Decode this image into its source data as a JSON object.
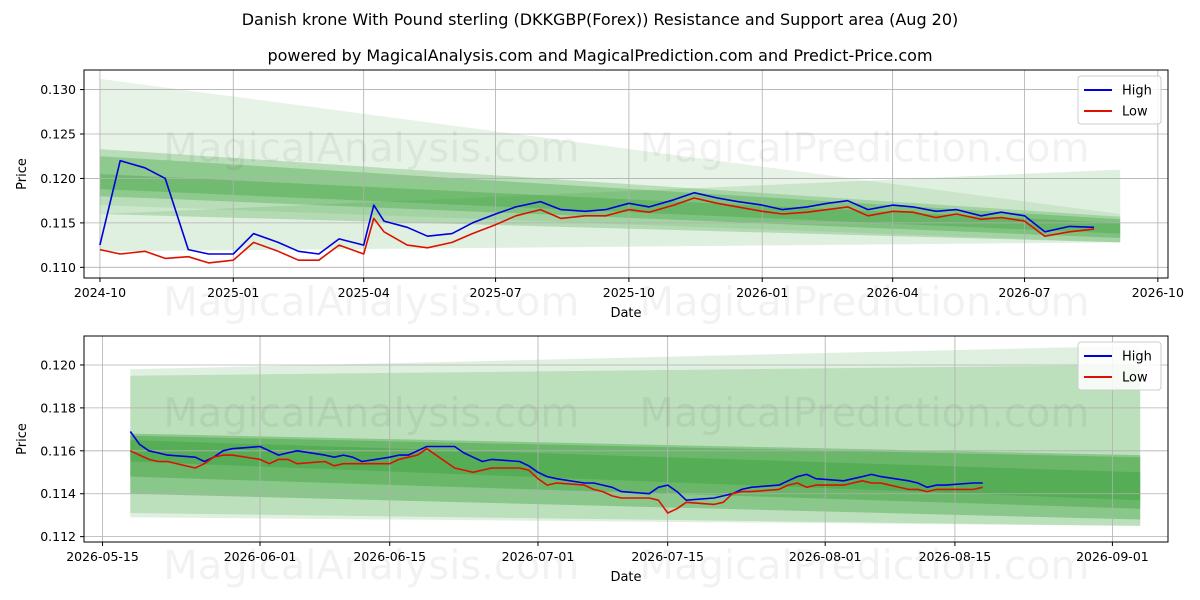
{
  "header": {
    "title": "Danish krone With Pound sterling (DKKGBP(Forex)) Resistance and Support area (Aug 20)",
    "subtitle": "powered by MagicalAnalysis.com and MagicalPrediction.com and Predict-Price.com"
  },
  "watermarks": [
    "MagicalAnalysis.com",
    "MagicalPrediction.com"
  ],
  "colors": {
    "high": "#0000dd",
    "low": "#dd1100",
    "band": "#2e9a2e",
    "grid": "#b0b0b0"
  },
  "chart_data": [
    {
      "type": "line",
      "xlabel": "Date",
      "ylabel": "Price",
      "xlim": [
        "2024-09-20",
        "2026-10-08"
      ],
      "ylim": [
        0.1088,
        0.1322
      ],
      "xticks": [
        "2024-10-01",
        "2025-01-01",
        "2025-04-01",
        "2025-07-01",
        "2025-10-01",
        "2026-01-01",
        "2026-04-01",
        "2026-07-01",
        "2026-10-01"
      ],
      "xtick_labels": [
        "2024-10",
        "2025-01",
        "2025-04",
        "2025-07",
        "2025-10",
        "2026-01",
        "2026-04",
        "2026-07",
        "2026-10"
      ],
      "yticks": [
        0.11,
        0.115,
        0.12,
        0.125,
        0.13
      ],
      "ytick_labels": [
        "0.110",
        "0.115",
        "0.120",
        "0.125",
        "0.130"
      ],
      "grid": true,
      "legend": "top-right",
      "legend_entries": [
        "High",
        "Low"
      ],
      "bands": [
        {
          "x": [
            "2024-10-01",
            "2026-09-05"
          ],
          "upper": [
            0.1312,
            0.116
          ],
          "lower": [
            0.117,
            0.1128
          ],
          "opacity": 0.12
        },
        {
          "x": [
            "2024-10-01",
            "2026-09-05"
          ],
          "upper": [
            0.1233,
            0.1157
          ],
          "lower": [
            0.116,
            0.1128
          ],
          "opacity": 0.25
        },
        {
          "x": [
            "2024-10-01",
            "2026-09-05"
          ],
          "upper": [
            0.1225,
            0.1154
          ],
          "lower": [
            0.118,
            0.1133
          ],
          "opacity": 0.3
        },
        {
          "x": [
            "2024-10-01",
            "2026-09-05"
          ],
          "upper": [
            0.1205,
            0.115
          ],
          "lower": [
            0.1188,
            0.1138
          ],
          "opacity": 0.3
        },
        {
          "x": [
            "2024-10-01",
            "2026-09-05"
          ],
          "upper": [
            0.116,
            0.121
          ],
          "lower": [
            0.1118,
            0.1128
          ],
          "opacity": 0.15
        }
      ],
      "series": [
        {
          "name": "High",
          "x": [
            "2024-10-01",
            "2024-10-15",
            "2024-11-01",
            "2024-11-15",
            "2024-12-01",
            "2024-12-15",
            "2025-01-01",
            "2025-01-15",
            "2025-02-01",
            "2025-02-15",
            "2025-03-01",
            "2025-03-15",
            "2025-04-01",
            "2025-04-08",
            "2025-04-15",
            "2025-05-01",
            "2025-05-15",
            "2025-06-01",
            "2025-06-15",
            "2025-07-01",
            "2025-07-15",
            "2025-08-01",
            "2025-08-15",
            "2025-09-01",
            "2025-09-15",
            "2025-10-01",
            "2025-10-15",
            "2025-11-01",
            "2025-11-15",
            "2025-12-01",
            "2025-12-15",
            "2026-01-01",
            "2026-01-15",
            "2026-02-01",
            "2026-02-15",
            "2026-03-01",
            "2026-03-15",
            "2026-04-01",
            "2026-04-15",
            "2026-05-01",
            "2026-05-15",
            "2026-06-01",
            "2026-06-15",
            "2026-07-01",
            "2026-07-15",
            "2026-08-01",
            "2026-08-18"
          ],
          "values": [
            0.1125,
            0.122,
            0.1212,
            0.12,
            0.112,
            0.1115,
            0.1115,
            0.1138,
            0.1128,
            0.1118,
            0.1115,
            0.1132,
            0.1125,
            0.117,
            0.1152,
            0.1145,
            0.1135,
            0.1138,
            0.115,
            0.116,
            0.1168,
            0.1174,
            0.1165,
            0.1163,
            0.1165,
            0.1172,
            0.1168,
            0.1176,
            0.1184,
            0.1178,
            0.1174,
            0.117,
            0.1165,
            0.1168,
            0.1172,
            0.1175,
            0.1165,
            0.117,
            0.1168,
            0.1163,
            0.1165,
            0.1158,
            0.1162,
            0.1158,
            0.114,
            0.1146,
            0.1145
          ]
        },
        {
          "name": "Low",
          "x": [
            "2024-10-01",
            "2024-10-15",
            "2024-11-01",
            "2024-11-15",
            "2024-12-01",
            "2024-12-15",
            "2025-01-01",
            "2025-01-15",
            "2025-02-01",
            "2025-02-15",
            "2025-03-01",
            "2025-03-15",
            "2025-04-01",
            "2025-04-08",
            "2025-04-15",
            "2025-05-01",
            "2025-05-15",
            "2025-06-01",
            "2025-06-15",
            "2025-07-01",
            "2025-07-15",
            "2025-08-01",
            "2025-08-15",
            "2025-09-01",
            "2025-09-15",
            "2025-10-01",
            "2025-10-15",
            "2025-11-01",
            "2025-11-15",
            "2025-12-01",
            "2025-12-15",
            "2026-01-01",
            "2026-01-15",
            "2026-02-01",
            "2026-02-15",
            "2026-03-01",
            "2026-03-15",
            "2026-04-01",
            "2026-04-15",
            "2026-05-01",
            "2026-05-15",
            "2026-06-01",
            "2026-06-15",
            "2026-07-01",
            "2026-07-15",
            "2026-08-01",
            "2026-08-18"
          ],
          "values": [
            0.112,
            0.1115,
            0.1118,
            0.111,
            0.1112,
            0.1105,
            0.1108,
            0.1128,
            0.1118,
            0.1108,
            0.1108,
            0.1125,
            0.1115,
            0.1155,
            0.114,
            0.1125,
            0.1122,
            0.1128,
            0.1138,
            0.1148,
            0.1158,
            0.1165,
            0.1155,
            0.1158,
            0.1158,
            0.1165,
            0.1162,
            0.117,
            0.1178,
            0.1172,
            0.1168,
            0.1163,
            0.116,
            0.1162,
            0.1165,
            0.1168,
            0.1158,
            0.1163,
            0.1162,
            0.1156,
            0.116,
            0.1154,
            0.1156,
            0.1152,
            0.1135,
            0.114,
            0.1143
          ]
        }
      ]
    },
    {
      "type": "line",
      "xlabel": "Date",
      "ylabel": "Price",
      "xlim": [
        "2026-05-13",
        "2026-09-07"
      ],
      "ylim": [
        0.11175,
        0.12135
      ],
      "xticks": [
        "2026-05-15",
        "2026-06-01",
        "2026-06-15",
        "2026-07-01",
        "2026-07-15",
        "2026-08-01",
        "2026-08-15",
        "2026-09-01"
      ],
      "xtick_labels": [
        "2026-05-15",
        "2026-06-01",
        "2026-06-15",
        "2026-07-01",
        "2026-07-15",
        "2026-08-01",
        "2026-08-15",
        "2026-09-01"
      ],
      "yticks": [
        0.112,
        0.114,
        0.116,
        0.118,
        0.12
      ],
      "ytick_labels": [
        "0.112",
        "0.114",
        "0.116",
        "0.118",
        "0.120"
      ],
      "grid": true,
      "legend": "top-right",
      "legend_entries": [
        "High",
        "Low"
      ],
      "bands": [
        {
          "x": [
            "2026-05-18",
            "2026-09-04"
          ],
          "upper": [
            0.1198,
            0.1209
          ],
          "lower": [
            0.1129,
            0.1125
          ],
          "opacity": 0.15
        },
        {
          "x": [
            "2026-05-18",
            "2026-09-04"
          ],
          "upper": [
            0.1195,
            0.12
          ],
          "lower": [
            0.1131,
            0.1125
          ],
          "opacity": 0.2
        },
        {
          "x": [
            "2026-05-18",
            "2026-09-04"
          ],
          "upper": [
            0.1168,
            0.1158
          ],
          "lower": [
            0.114,
            0.1128
          ],
          "opacity": 0.35
        },
        {
          "x": [
            "2026-05-18",
            "2026-09-04"
          ],
          "upper": [
            0.1167,
            0.1157
          ],
          "lower": [
            0.1148,
            0.1133
          ],
          "opacity": 0.35
        },
        {
          "x": [
            "2026-05-18",
            "2026-09-04"
          ],
          "upper": [
            0.1165,
            0.115
          ],
          "lower": [
            0.1155,
            0.1137
          ],
          "opacity": 0.35
        }
      ],
      "series": [
        {
          "name": "High",
          "x": [
            "2026-05-18",
            "2026-05-19",
            "2026-05-20",
            "2026-05-21",
            "2026-05-22",
            "2026-05-25",
            "2026-05-26",
            "2026-05-27",
            "2026-05-28",
            "2026-05-29",
            "2026-06-01",
            "2026-06-02",
            "2026-06-03",
            "2026-06-04",
            "2026-06-05",
            "2026-06-08",
            "2026-06-09",
            "2026-06-10",
            "2026-06-11",
            "2026-06-12",
            "2026-06-15",
            "2026-06-16",
            "2026-06-17",
            "2026-06-18",
            "2026-06-19",
            "2026-06-22",
            "2026-06-23",
            "2026-06-24",
            "2026-06-25",
            "2026-06-26",
            "2026-06-29",
            "2026-06-30",
            "2026-07-01",
            "2026-07-02",
            "2026-07-03",
            "2026-07-06",
            "2026-07-07",
            "2026-07-08",
            "2026-07-09",
            "2026-07-10",
            "2026-07-13",
            "2026-07-14",
            "2026-07-15",
            "2026-07-16",
            "2026-07-17",
            "2026-07-20",
            "2026-07-21",
            "2026-07-22",
            "2026-07-23",
            "2026-07-24",
            "2026-07-27",
            "2026-07-28",
            "2026-07-29",
            "2026-07-30",
            "2026-07-31",
            "2026-08-03",
            "2026-08-04",
            "2026-08-05",
            "2026-08-06",
            "2026-08-07",
            "2026-08-10",
            "2026-08-11",
            "2026-08-12",
            "2026-08-13",
            "2026-08-14",
            "2026-08-17",
            "2026-08-18"
          ],
          "values": [
            0.1169,
            0.1163,
            0.116,
            0.1159,
            0.1158,
            0.1157,
            0.1155,
            0.1157,
            0.116,
            0.1161,
            0.1162,
            0.116,
            0.1158,
            0.1159,
            0.116,
            0.1158,
            0.1157,
            0.1158,
            0.1157,
            0.1155,
            0.1157,
            0.1158,
            0.1158,
            0.116,
            0.1162,
            0.1162,
            0.1159,
            0.1157,
            0.1155,
            0.1156,
            0.1155,
            0.1153,
            0.115,
            0.1148,
            0.1147,
            0.1145,
            0.1145,
            0.1144,
            0.1143,
            0.1141,
            0.114,
            0.1143,
            0.1144,
            0.1141,
            0.1137,
            0.1138,
            0.1139,
            0.114,
            0.1142,
            0.1143,
            0.1144,
            0.1146,
            0.1148,
            0.1149,
            0.1147,
            0.1146,
            0.1147,
            0.1148,
            0.1149,
            0.1148,
            0.1146,
            0.1145,
            0.1143,
            0.1144,
            0.1144,
            0.1145,
            0.1145
          ]
        },
        {
          "name": "Low",
          "x": [
            "2026-05-18",
            "2026-05-19",
            "2026-05-20",
            "2026-05-21",
            "2026-05-22",
            "2026-05-25",
            "2026-05-26",
            "2026-05-27",
            "2026-05-28",
            "2026-05-29",
            "2026-06-01",
            "2026-06-02",
            "2026-06-03",
            "2026-06-04",
            "2026-06-05",
            "2026-06-08",
            "2026-06-09",
            "2026-06-10",
            "2026-06-11",
            "2026-06-12",
            "2026-06-15",
            "2026-06-16",
            "2026-06-17",
            "2026-06-18",
            "2026-06-19",
            "2026-06-22",
            "2026-06-23",
            "2026-06-24",
            "2026-06-25",
            "2026-06-26",
            "2026-06-29",
            "2026-06-30",
            "2026-07-01",
            "2026-07-02",
            "2026-07-03",
            "2026-07-06",
            "2026-07-07",
            "2026-07-08",
            "2026-07-09",
            "2026-07-10",
            "2026-07-13",
            "2026-07-14",
            "2026-07-15",
            "2026-07-16",
            "2026-07-17",
            "2026-07-20",
            "2026-07-21",
            "2026-07-22",
            "2026-07-23",
            "2026-07-24",
            "2026-07-27",
            "2026-07-28",
            "2026-07-29",
            "2026-07-30",
            "2026-07-31",
            "2026-08-03",
            "2026-08-04",
            "2026-08-05",
            "2026-08-06",
            "2026-08-07",
            "2026-08-10",
            "2026-08-11",
            "2026-08-12",
            "2026-08-13",
            "2026-08-14",
            "2026-08-17",
            "2026-08-18"
          ],
          "values": [
            0.116,
            0.1158,
            0.1156,
            0.1155,
            0.1155,
            0.1152,
            0.1154,
            0.1157,
            0.1158,
            0.1158,
            0.1156,
            0.1154,
            0.1156,
            0.1156,
            0.1154,
            0.1155,
            0.1153,
            0.1154,
            0.1154,
            0.1154,
            0.1154,
            0.1156,
            0.1157,
            0.1158,
            0.1161,
            0.1152,
            0.1151,
            0.115,
            0.1151,
            0.1152,
            0.1152,
            0.1151,
            0.1147,
            0.1144,
            0.1145,
            0.1144,
            0.1142,
            0.1141,
            0.1139,
            0.1138,
            0.1138,
            0.1137,
            0.1131,
            0.1133,
            0.1136,
            0.1135,
            0.1136,
            0.114,
            0.1141,
            0.1141,
            0.1142,
            0.1144,
            0.1145,
            0.1143,
            0.1144,
            0.1144,
            0.1145,
            0.1146,
            0.1145,
            0.1145,
            0.1142,
            0.1142,
            0.1141,
            0.1142,
            0.1142,
            0.1142,
            0.1143
          ]
        }
      ]
    }
  ]
}
